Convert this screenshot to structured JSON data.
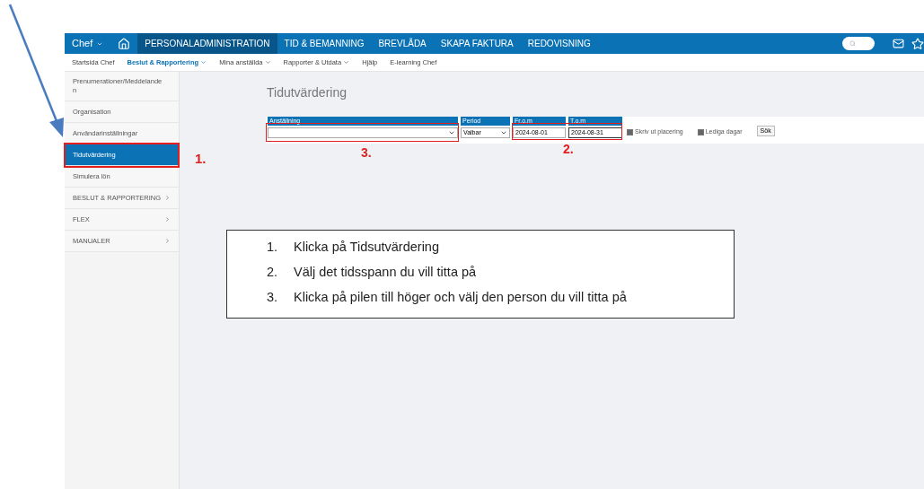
{
  "top_nav": {
    "role_menu": "Chef",
    "items": [
      {
        "label": "PERSONALADMINISTRATION",
        "selected": true
      },
      {
        "label": "TID & BEMANNING",
        "selected": false
      },
      {
        "label": "BREVLÅDA",
        "selected": false
      },
      {
        "label": "SKAPA FAKTURA",
        "selected": false
      },
      {
        "label": "REDOVISNING",
        "selected": false
      }
    ]
  },
  "sub_nav": [
    {
      "label": "Startsida Chef",
      "selected": false,
      "has_menu": false
    },
    {
      "label": "Beslut & Rapportering",
      "selected": true,
      "has_menu": true
    },
    {
      "label": "Mina anställda",
      "selected": false,
      "has_menu": true
    },
    {
      "label": "Rapporter & Utdata",
      "selected": false,
      "has_menu": true
    },
    {
      "label": "Hjälp",
      "selected": false,
      "has_menu": false
    },
    {
      "label": "E-learning Chef",
      "selected": false,
      "has_menu": false
    }
  ],
  "sidebar": [
    {
      "label": "Prenumerationer/Meddelanden",
      "kind": "link",
      "selected": false
    },
    {
      "label": "Organisation",
      "kind": "link",
      "selected": false
    },
    {
      "label": "Användarinställningar",
      "kind": "link",
      "selected": false
    },
    {
      "label": "Tidutvärdering",
      "kind": "link",
      "selected": true
    },
    {
      "label": "Simulera lön",
      "kind": "link",
      "selected": false
    },
    {
      "label": "BESLUT & RAPPORTERING",
      "kind": "section",
      "selected": false
    },
    {
      "label": "FLEX",
      "kind": "section",
      "selected": false
    },
    {
      "label": "MANUALER",
      "kind": "section",
      "selected": false
    }
  ],
  "page_title": "Tidutvärdering",
  "filter": {
    "employment_label": "Anställning",
    "period_label": "Period",
    "period_value": "Valbar",
    "from_label": "Fr.o.m",
    "from_value": "2024-08-01",
    "to_label": "T.o.m",
    "to_value": "2024-08-31",
    "checkboxes": [
      {
        "label": "Skriv ut placering",
        "checked": true
      },
      {
        "label": "Lediga dagar",
        "checked": true
      }
    ],
    "search_button": "Sök"
  },
  "callouts": [
    "1.",
    "2.",
    "3."
  ],
  "instructions": [
    {
      "number": "1.",
      "text": "Klicka på Tidsutvärdering"
    },
    {
      "number": "2.",
      "text": "Välj det tidsspann du vill titta på"
    },
    {
      "number": "3.",
      "text": "Klicka på pilen till höger och välj den person du vill titta på"
    }
  ]
}
